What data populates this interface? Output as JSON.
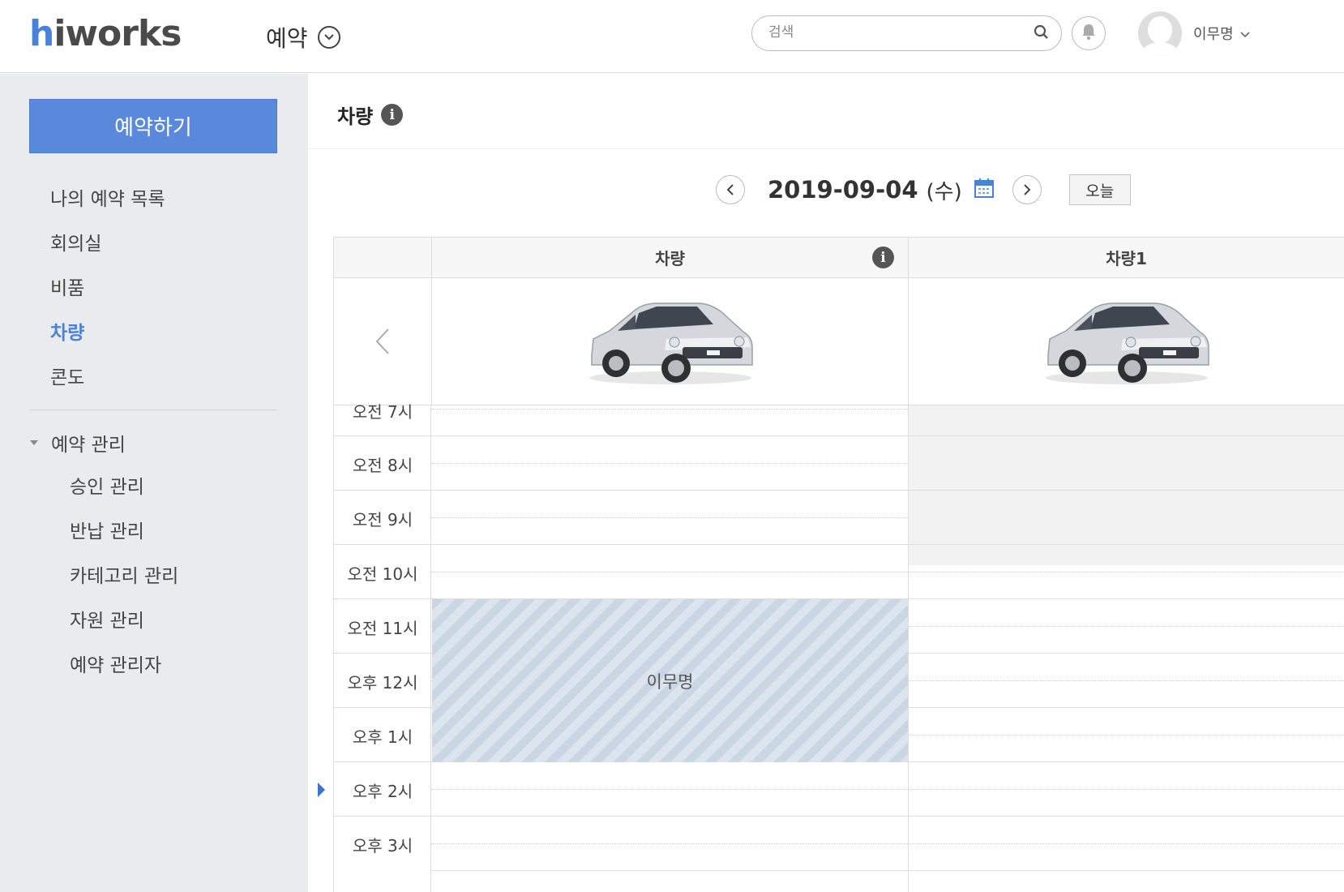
{
  "header": {
    "logo_h": "h",
    "logo_rest": "iworks",
    "app_title": "예약",
    "search_placeholder": "검색",
    "user_name": "이무명"
  },
  "sidebar": {
    "reserve_button": "예약하기",
    "nav": [
      {
        "label": "나의 예약 목록",
        "active": false
      },
      {
        "label": "회의실",
        "active": false
      },
      {
        "label": "비품",
        "active": false
      },
      {
        "label": "차량",
        "active": true
      },
      {
        "label": "콘도",
        "active": false
      }
    ],
    "management": {
      "label": "예약 관리",
      "items": [
        "승인 관리",
        "반납 관리",
        "카테고리 관리",
        "자원 관리",
        "예약 관리자"
      ]
    }
  },
  "main": {
    "page_title": "차량",
    "info_glyph": "i",
    "date": "2019-09-04",
    "day_of_week": "(수)",
    "today_button": "오늘",
    "resources": [
      {
        "name": "차량",
        "has_info": true
      },
      {
        "name": "차량1",
        "has_info": false
      }
    ],
    "time_labels": [
      "오전 7시",
      "오전 8시",
      "오전 9시",
      "오전 10시",
      "오전 11시",
      "오후 12시",
      "오후 1시",
      "오후 2시",
      "오후 3시"
    ],
    "booking": {
      "resource": "차량",
      "label": "이무명",
      "start": "오전 11시",
      "end": "오후 2시"
    }
  },
  "colors": {
    "accent": "#4a82d9",
    "button": "#5a89dc",
    "booking": "#c9d6e4",
    "sidebar_bg": "#e9ebee"
  }
}
